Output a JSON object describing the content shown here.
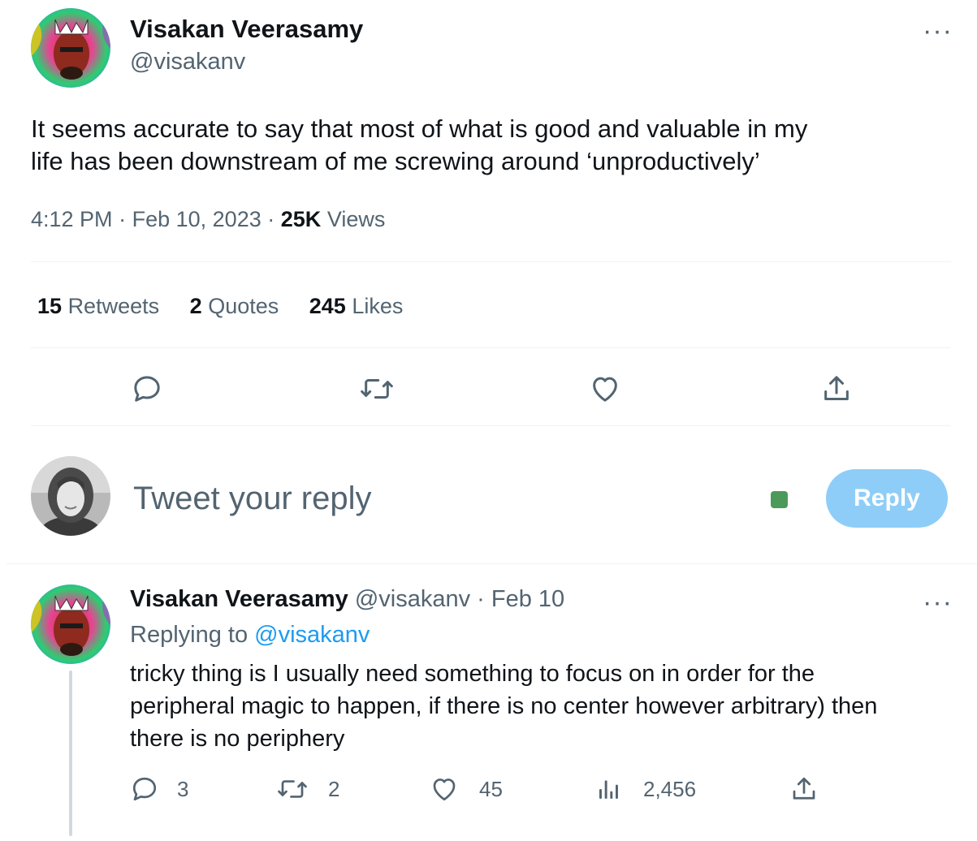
{
  "main_tweet": {
    "author_name": "Visakan Veerasamy",
    "author_handle": "@visakanv",
    "text_line1": "It seems accurate to say that most of what is good and valuable in my",
    "text_line2": "life has been downstream of me screwing around ‘unproductively’",
    "time": "4:12 PM",
    "sep1": "·",
    "date": "Feb 10, 2023",
    "sep2": "·",
    "views_count": "25K",
    "views_label": "Views",
    "retweets_count": "15",
    "retweets_label": "Retweets",
    "quotes_count": "2",
    "quotes_label": "Quotes",
    "likes_count": "245",
    "likes_label": "Likes",
    "more_label": "···"
  },
  "composer": {
    "placeholder": "Tweet your reply",
    "reply_button": "Reply"
  },
  "reply_tweet": {
    "author_name": "Visakan Veerasamy",
    "author_handle": "@visakanv",
    "sep": "·",
    "date": "Feb 10",
    "replying_to_label": "Replying to",
    "replying_to_handle": "@visakanv",
    "text_line1": "tricky thing is I usually need something to focus on in order for the",
    "text_line2": "peripheral magic to happen, if there is no center however arbitrary) then",
    "text_line3": "there is no periphery",
    "reply_count": "3",
    "retweet_count": "2",
    "like_count": "45",
    "views_count": "2,456",
    "more_label": "···"
  },
  "colors": {
    "accent": "#1d9bf0",
    "reply_button_disabled": "#8ecdf8",
    "muted_text": "#536471",
    "divider": "#eff3f4",
    "status_dot": "#4c9a5a"
  },
  "icons": {
    "reply": "reply-icon",
    "retweet": "retweet-icon",
    "like": "heart-icon",
    "share": "share-icon",
    "views": "views-icon",
    "more": "more-icon"
  }
}
